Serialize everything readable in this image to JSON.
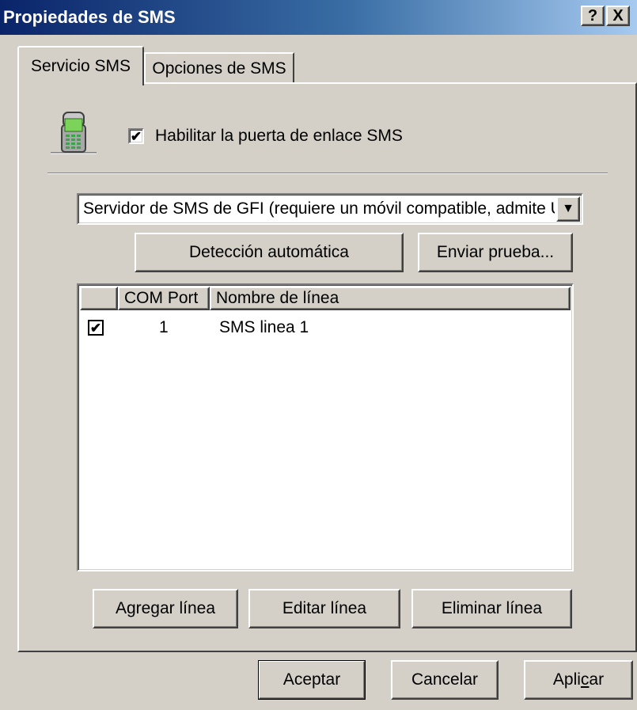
{
  "window": {
    "title": "Propiedades de SMS",
    "help_button": "?",
    "close_button": "X"
  },
  "tabs": [
    {
      "label": "Servicio SMS",
      "selected": true
    },
    {
      "label": "Opciones de SMS",
      "selected": false
    }
  ],
  "service": {
    "icon": "mobile-phone-icon",
    "enable_label": "Habilitar la puerta de enlace SMS",
    "enable_checked": true,
    "provider_selected": "Servidor de SMS de GFI (requiere un móvil compatible, admite U",
    "autodetect_button": "Detección automática",
    "send_test_button": "Enviar prueba..."
  },
  "lines_table": {
    "columns": [
      "",
      "COM Port",
      "Nombre de línea"
    ],
    "rows": [
      {
        "checked": true,
        "com_port": "1",
        "name": "SMS linea 1"
      }
    ]
  },
  "line_buttons": {
    "add": "Agregar línea",
    "edit": "Editar línea",
    "delete": "Eliminar línea"
  },
  "dialog_buttons": {
    "ok": "Aceptar",
    "cancel": "Cancelar",
    "apply_pre": "Apli",
    "apply_ul": "c",
    "apply_post": "ar"
  }
}
